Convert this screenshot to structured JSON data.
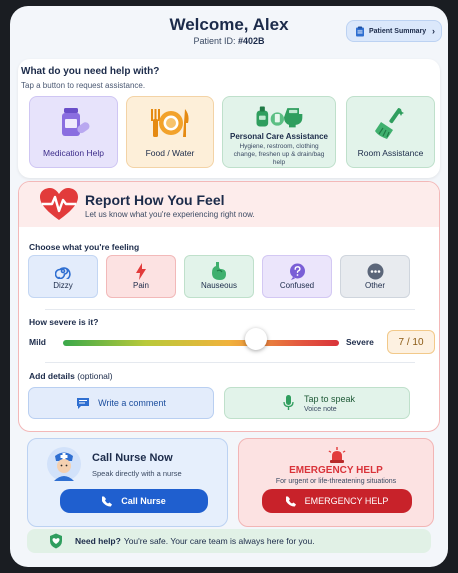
{
  "header": {
    "title": "Welcome, Alex",
    "patient_id_label": "Patient ID:",
    "patient_id": "#402B",
    "summary_button": "Patient Summary"
  },
  "help_section": {
    "title": "What do you need help with?",
    "subtitle": "Tap a button to request assistance.",
    "tiles": [
      {
        "label": "Medication Help",
        "icon": "pill-bottle-icon",
        "color": "#e7e3fb"
      },
      {
        "label": "Food / Water",
        "icon": "plate-cutlery-icon",
        "color": "#fdefd9"
      },
      {
        "label": "Personal Care Assistance",
        "sublabel": "Hygiene, restroom, clothing change, freshen up & drain/bag help",
        "icon": "personal-care-icon",
        "color": "#e2f3ea"
      },
      {
        "label": "Room Assistance",
        "icon": "broom-icon",
        "color": "#e2f3ea"
      }
    ]
  },
  "report": {
    "title": "Report How You Feel",
    "subtitle": "Let us know what you're experiencing right now.",
    "feelings_label": "Choose what you're feeling",
    "feelings": [
      {
        "label": "Dizzy",
        "icon": "dizzy-spiral-icon"
      },
      {
        "label": "Pain",
        "icon": "lightning-icon"
      },
      {
        "label": "Nauseous",
        "icon": "stomach-icon"
      },
      {
        "label": "Confused",
        "icon": "question-bubble-icon"
      },
      {
        "label": "Other",
        "icon": "more-dots-icon"
      }
    ],
    "severity_label": "How severe is it?",
    "severity_min_label": "Mild",
    "severity_max_label": "Severe",
    "severity_value": 7,
    "severity_max": 10,
    "severity_display": "7 / 10",
    "details_label": "Add details",
    "details_optional": "(optional)",
    "comment_button": "Write a comment",
    "speak_button": "Tap to speak",
    "speak_sub": "Voice note"
  },
  "nurse_card": {
    "title": "Call Nurse Now",
    "subtitle": "Speak directly with a nurse",
    "button": "Call Nurse"
  },
  "emergency_card": {
    "title": "EMERGENCY HELP",
    "subtitle": "For urgent or life-threatening situations",
    "button": "EMERGENCY HELP"
  },
  "help_bar": {
    "bold": "Need help?",
    "text": "You're safe. Your care team is always here for you."
  }
}
